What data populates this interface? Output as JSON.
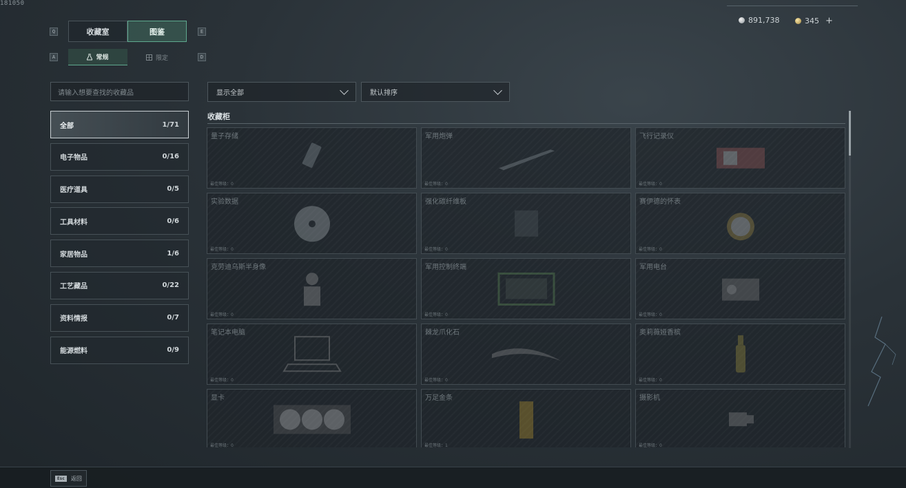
{
  "build_id": "181050",
  "hotkeys": {
    "main_prev": "Q",
    "main_next": "E",
    "sub_prev": "A",
    "sub_next": "D"
  },
  "main_tabs": [
    {
      "label": "收藏室",
      "active": false
    },
    {
      "label": "图鉴",
      "active": true
    }
  ],
  "sub_tabs": [
    {
      "label": "常规",
      "icon": "flask-icon",
      "active": true
    },
    {
      "label": "限定",
      "icon": "puzzle-icon",
      "active": false
    }
  ],
  "currency": {
    "silver": {
      "icon": "silver-coin-icon",
      "value": "891,738"
    },
    "gold": {
      "icon": "gold-coin-icon",
      "value": "345"
    },
    "add": "+"
  },
  "search": {
    "placeholder": "请输入想要查找的收藏品"
  },
  "filters": {
    "display": "显示全部",
    "sort": "默认排序"
  },
  "categories": [
    {
      "label": "全部",
      "count": "1/71",
      "active": true
    },
    {
      "label": "电子物品",
      "count": "0/16"
    },
    {
      "label": "医疗道具",
      "count": "0/5"
    },
    {
      "label": "工具材料",
      "count": "0/6"
    },
    {
      "label": "家居物品",
      "count": "1/6"
    },
    {
      "label": "工艺藏品",
      "count": "0/22"
    },
    {
      "label": "资料情报",
      "count": "0/7"
    },
    {
      "label": "能源燃料",
      "count": "0/9"
    }
  ],
  "section_title": "收藏柜",
  "items": [
    {
      "name": "量子存储",
      "footer": "最佳等级：0",
      "art": "chip"
    },
    {
      "name": "军用炮弹",
      "footer": "最佳等级：0",
      "art": "shell"
    },
    {
      "name": "飞行记录仪",
      "footer": "最佳等级：0",
      "art": "recorder"
    },
    {
      "name": "实验数据",
      "footer": "最佳等级：0",
      "art": "disc"
    },
    {
      "name": "强化碳纤维板",
      "footer": "最佳等级：0",
      "art": "plate"
    },
    {
      "name": "赛伊德的怀表",
      "footer": "最佳等级：0",
      "art": "watch"
    },
    {
      "name": "克劳迪乌斯半身像",
      "footer": "最佳等级：0",
      "art": "bust"
    },
    {
      "name": "军用控制终端",
      "footer": "最佳等级：0",
      "art": "terminal"
    },
    {
      "name": "军用电台",
      "footer": "最佳等级：0",
      "art": "radio"
    },
    {
      "name": "笔记本电脑",
      "footer": "最佳等级：0",
      "art": "laptop"
    },
    {
      "name": "棘龙爪化石",
      "footer": "最佳等级：0",
      "art": "claw"
    },
    {
      "name": "奥莉薇娅香槟",
      "footer": "最佳等级：0",
      "art": "bottle"
    },
    {
      "name": "显卡",
      "footer": "最佳等级：0",
      "art": "gpu"
    },
    {
      "name": "万足金条",
      "footer": "最佳等级：1",
      "art": "goldbar"
    },
    {
      "name": "摄影机",
      "footer": "最佳等级：0",
      "art": "camera"
    }
  ],
  "bottom": {
    "esc_key": "Esc",
    "esc_label": "返回"
  }
}
